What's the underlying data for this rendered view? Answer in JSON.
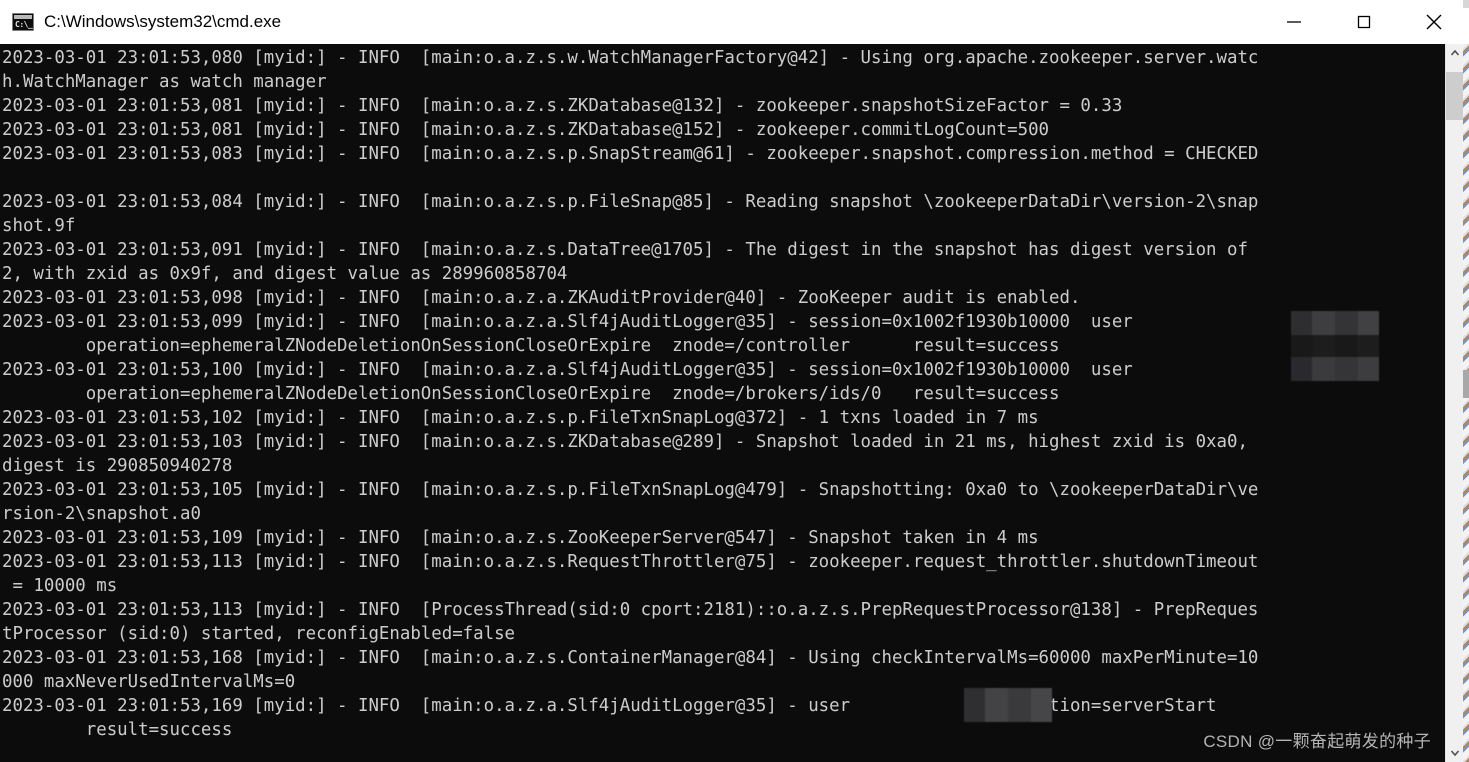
{
  "window": {
    "title": "C:\\Windows\\system32\\cmd.exe",
    "icon": "cmd-console-icon",
    "icon_prompt": "C:\\_",
    "controls": {
      "minimize": "minimize-button",
      "maximize": "maximize-button",
      "close": "close-button"
    }
  },
  "console": {
    "background_color": "#0c0c0c",
    "text_color": "#cccccc",
    "lines": [
      "2023-03-01 23:01:53,080 [myid:] - INFO  [main:o.a.z.s.w.WatchManagerFactory@42] - Using org.apache.zookeeper.server.watc",
      "h.WatchManager as watch manager",
      "2023-03-01 23:01:53,081 [myid:] - INFO  [main:o.a.z.s.ZKDatabase@132] - zookeeper.snapshotSizeFactor = 0.33",
      "2023-03-01 23:01:53,081 [myid:] - INFO  [main:o.a.z.s.ZKDatabase@152] - zookeeper.commitLogCount=500",
      "2023-03-01 23:01:53,083 [myid:] - INFO  [main:o.a.z.s.p.SnapStream@61] - zookeeper.snapshot.compression.method = CHECKED",
      "",
      "2023-03-01 23:01:53,084 [myid:] - INFO  [main:o.a.z.s.p.FileSnap@85] - Reading snapshot \\zookeeperDataDir\\version-2\\snap",
      "shot.9f",
      "2023-03-01 23:01:53,091 [myid:] - INFO  [main:o.a.z.s.DataTree@1705] - The digest in the snapshot has digest version of",
      "2, with zxid as 0x9f, and digest value as 289960858704",
      "2023-03-01 23:01:53,098 [myid:] - INFO  [main:o.a.z.a.ZKAuditProvider@40] - ZooKeeper audit is enabled.",
      "2023-03-01 23:01:53,099 [myid:] - INFO  [main:o.a.z.a.Slf4jAuditLogger@35] - session=0x1002f1930b10000  user",
      "        operation=ephemeralZNodeDeletionOnSessionCloseOrExpire  znode=/controller      result=success",
      "2023-03-01 23:01:53,100 [myid:] - INFO  [main:o.a.z.a.Slf4jAuditLogger@35] - session=0x1002f1930b10000  user",
      "        operation=ephemeralZNodeDeletionOnSessionCloseOrExpire  znode=/brokers/ids/0   result=success",
      "2023-03-01 23:01:53,102 [myid:] - INFO  [main:o.a.z.s.p.FileTxnSnapLog@372] - 1 txns loaded in 7 ms",
      "2023-03-01 23:01:53,103 [myid:] - INFO  [main:o.a.z.s.ZKDatabase@289] - Snapshot loaded in 21 ms, highest zxid is 0xa0,",
      "digest is 290850940278",
      "2023-03-01 23:01:53,105 [myid:] - INFO  [main:o.a.z.s.p.FileTxnSnapLog@479] - Snapshotting: 0xa0 to \\zookeeperDataDir\\ve",
      "rsion-2\\snapshot.a0",
      "2023-03-01 23:01:53,109 [myid:] - INFO  [main:o.a.z.s.ZooKeeperServer@547] - Snapshot taken in 4 ms",
      "2023-03-01 23:01:53,113 [myid:] - INFO  [main:o.a.z.s.RequestThrottler@75] - zookeeper.request_throttler.shutdownTimeout",
      " = 10000 ms",
      "2023-03-01 23:01:53,113 [myid:] - INFO  [ProcessThread(sid:0 cport:2181)::o.a.z.s.PrepRequestProcessor@138] - PrepReques",
      "tProcessor (sid:0) started, reconfigEnabled=false",
      "2023-03-01 23:01:53,168 [myid:] - INFO  [main:o.a.z.s.ContainerManager@84] - Using checkIntervalMs=60000 maxPerMinute=10",
      "000 maxNeverUsedIntervalMs=0",
      "2023-03-01 23:01:53,169 [myid:] - INFO  [main:o.a.z.a.Slf4jAuditLogger@35] - user              operation=serverStart",
      "        result=success"
    ],
    "redactions": [
      {
        "name": "redacted-username-1",
        "note": "mosaic block over username value"
      },
      {
        "name": "redacted-username-2",
        "note": "mosaic block over username value"
      }
    ]
  },
  "watermark": {
    "text": "CSDN @一颗奋起萌发的种子"
  },
  "scrollbar": {
    "up_arrow": "scroll-up-arrow",
    "down_arrow": "scroll-down-arrow",
    "thumb": "scroll-thumb"
  }
}
